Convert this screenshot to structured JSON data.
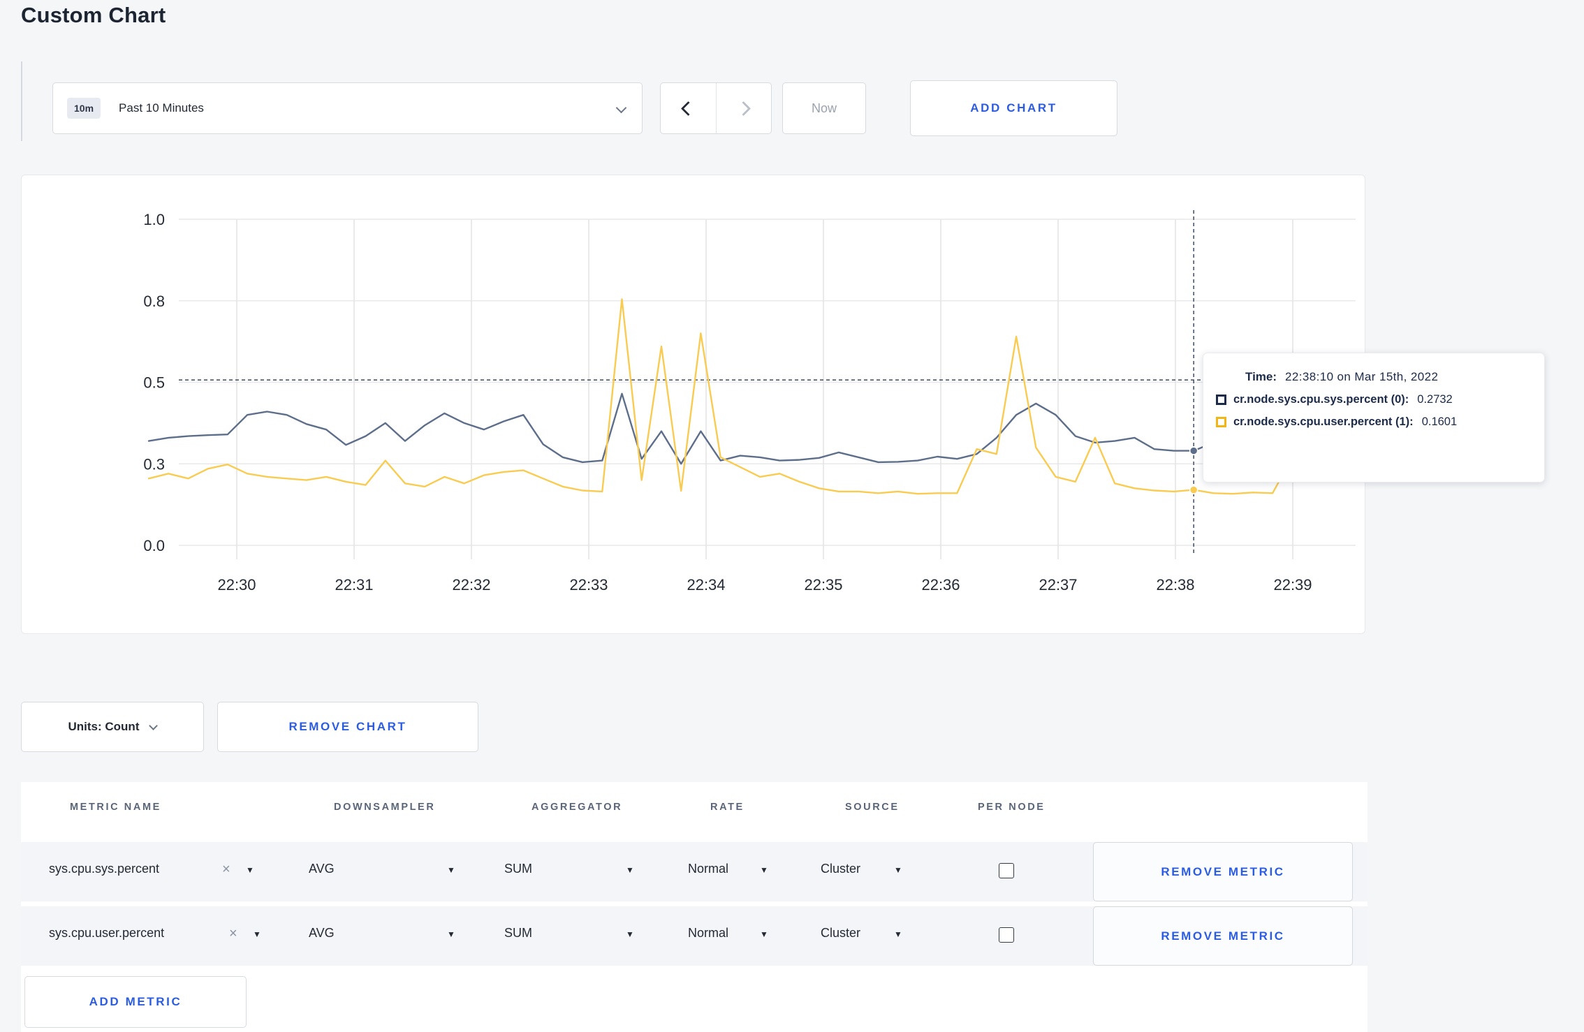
{
  "page": {
    "title": "Custom Chart"
  },
  "toolbar": {
    "time_window_badge": "10m",
    "time_window_label": "Past 10 Minutes",
    "now_label": "Now",
    "add_chart_label": "ADD CHART"
  },
  "chart": {
    "y_tick_labels": [
      "0.0",
      "0.3",
      "0.5",
      "0.8",
      "1.0"
    ],
    "y_tick_values": [
      0,
      0.25,
      0.5,
      0.75,
      1.0
    ],
    "x_tick_labels": [
      "22:30",
      "22:31",
      "22:32",
      "22:33",
      "22:34",
      "22:35",
      "22:36",
      "22:37",
      "22:38",
      "22:39"
    ],
    "colors": {
      "sys_line": "#5d6e8b",
      "user_line": "#f9cb50",
      "sys_legend": "#1c2b4a",
      "user_legend": "#f3b415",
      "grid": "#e9e9e9",
      "crosshair": "#47586e"
    },
    "crosshair": {
      "point_index": 53,
      "hline_value": 0.507
    }
  },
  "chart_data": {
    "type": "line",
    "title": "",
    "xlabel": "",
    "ylabel": "",
    "ylim": [
      0,
      1.0
    ],
    "x_start_time": "22:29:20",
    "x_interval_seconds": 10,
    "x_tick_labels": [
      "22:30",
      "22:31",
      "22:32",
      "22:33",
      "22:34",
      "22:35",
      "22:36",
      "22:37",
      "22:38",
      "22:39"
    ],
    "y_tick_labels": [
      "0.0",
      "0.3",
      "0.5",
      "0.8",
      "1.0"
    ],
    "legend_position": "tooltip",
    "grid": true,
    "series": [
      {
        "name": "cr.node.sys.cpu.sys.percent",
        "color": "#5d6e8b",
        "values": [
          0.32,
          0.33,
          0.335,
          0.338,
          0.34,
          0.4,
          0.41,
          0.4,
          0.372,
          0.355,
          0.308,
          0.335,
          0.375,
          0.32,
          0.368,
          0.405,
          0.375,
          0.355,
          0.38,
          0.4,
          0.31,
          0.27,
          0.255,
          0.26,
          0.465,
          0.265,
          0.35,
          0.25,
          0.35,
          0.26,
          0.275,
          0.27,
          0.26,
          0.262,
          0.268,
          0.285,
          0.27,
          0.255,
          0.256,
          0.26,
          0.272,
          0.265,
          0.28,
          0.33,
          0.4,
          0.435,
          0.4,
          0.335,
          0.315,
          0.32,
          0.33,
          0.295,
          0.29,
          0.29,
          0.315,
          0.33,
          0.32,
          0.3,
          0.305,
          0.31,
          0.305,
          0.3
        ]
      },
      {
        "name": "cr.node.sys.cpu.user.percent",
        "color": "#f9cb50",
        "values": [
          0.205,
          0.22,
          0.205,
          0.235,
          0.248,
          0.22,
          0.21,
          0.205,
          0.2,
          0.21,
          0.195,
          0.185,
          0.26,
          0.19,
          0.18,
          0.21,
          0.19,
          0.215,
          0.225,
          0.23,
          0.205,
          0.18,
          0.168,
          0.165,
          0.755,
          0.2,
          0.61,
          0.167,
          0.65,
          0.27,
          0.24,
          0.21,
          0.22,
          0.195,
          0.175,
          0.165,
          0.165,
          0.16,
          0.165,
          0.158,
          0.16,
          0.16,
          0.295,
          0.28,
          0.64,
          0.3,
          0.21,
          0.195,
          0.33,
          0.19,
          0.175,
          0.168,
          0.165,
          0.17,
          0.16,
          0.158,
          0.162,
          0.16,
          0.27,
          0.24,
          0.26,
          0.245
        ]
      }
    ]
  },
  "tooltip": {
    "time_label": "Time:",
    "time_value": "22:38:10 on Mar 15th, 2022",
    "entries": [
      {
        "name": "cr.node.sys.cpu.sys.percent (0):",
        "value": "0.2732"
      },
      {
        "name": "cr.node.sys.cpu.user.percent (1):",
        "value": "0.1601"
      }
    ]
  },
  "chart_controls": {
    "units_label": "Units: Count",
    "remove_chart_label": "REMOVE CHART"
  },
  "metrics_table": {
    "headers": [
      "METRIC NAME",
      "DOWNSAMPLER",
      "AGGREGATOR",
      "RATE",
      "SOURCE",
      "PER NODE"
    ],
    "rows": [
      {
        "metric": "sys.cpu.sys.percent",
        "downsampler": "AVG",
        "aggregator": "SUM",
        "rate": "Normal",
        "source": "Cluster",
        "per_node": false,
        "remove_label": "REMOVE METRIC"
      },
      {
        "metric": "sys.cpu.user.percent",
        "downsampler": "AVG",
        "aggregator": "SUM",
        "rate": "Normal",
        "source": "Cluster",
        "per_node": false,
        "remove_label": "REMOVE METRIC"
      }
    ],
    "add_metric_label": "ADD METRIC"
  }
}
